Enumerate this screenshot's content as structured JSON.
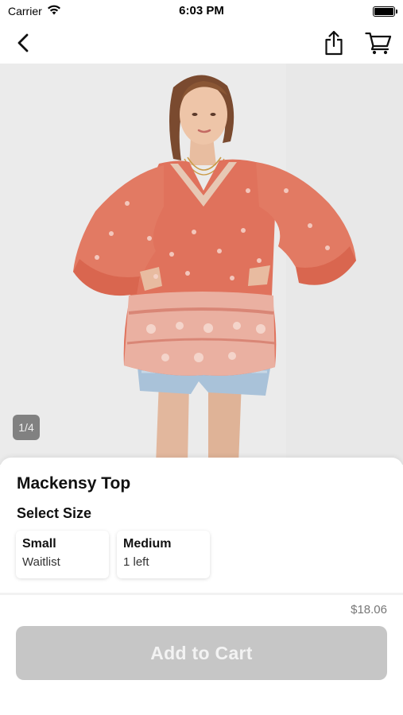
{
  "status_bar": {
    "carrier": "Carrier",
    "time": "6:03 PM",
    "battery_level": 1.0
  },
  "nav": {
    "back_icon": "chevron-left-icon",
    "share_icon": "share-icon",
    "cart_icon": "cart-icon"
  },
  "gallery": {
    "counter": "1/4"
  },
  "product": {
    "title": "Mackensy Top",
    "select_size_label": "Select Size",
    "sizes": [
      {
        "name": "Small",
        "status": "Waitlist"
      },
      {
        "name": "Medium",
        "status": "1 left"
      }
    ],
    "price": "$18.06",
    "add_to_cart_label": "Add to Cart"
  },
  "colors": {
    "disabled_button": "#c6c6c6",
    "blouse": "#e0725c"
  }
}
